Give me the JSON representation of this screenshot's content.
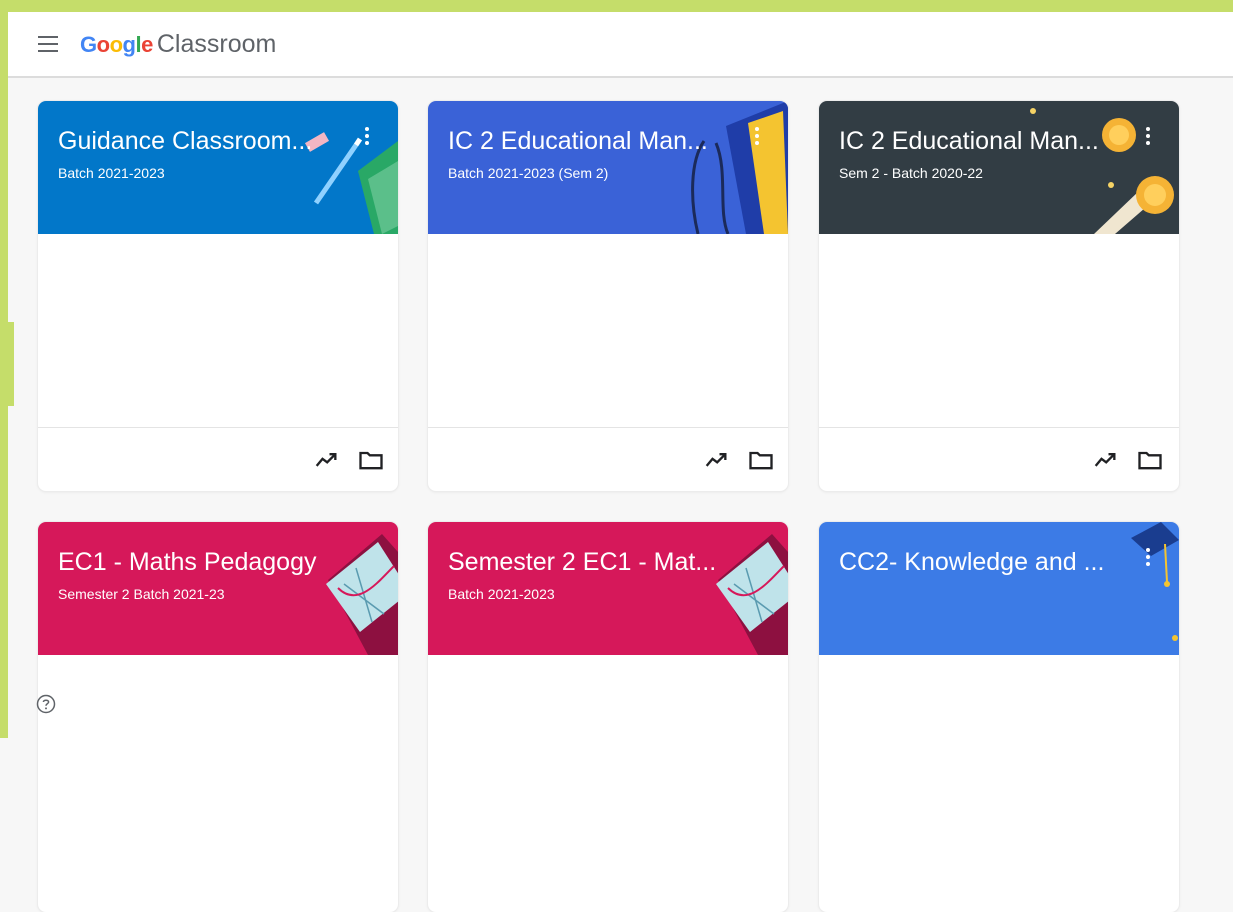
{
  "app": {
    "logo_google": [
      "G",
      "o",
      "o",
      "g",
      "l",
      "e"
    ],
    "logo_classroom": "Classroom",
    "icons": {
      "menu": "hamburger-menu-icon",
      "help": "help-circle-icon",
      "trend": "trending-up-icon",
      "folder": "folder-icon",
      "more": "more-vert-icon"
    }
  },
  "cards": [
    {
      "title": "Guidance Classroom...",
      "subtitle": "Batch 2021-2023",
      "color": "#0277c9"
    },
    {
      "title": "IC 2 Educational Man...",
      "subtitle": "Batch 2021-2023 (Sem 2)",
      "color": "#3a62d7"
    },
    {
      "title": "IC 2 Educational Man...",
      "subtitle": "Sem 2 - Batch 2020-22",
      "color": "#323d44"
    },
    {
      "title": "EC1 - Maths Pedagogy",
      "subtitle": "Semester 2 Batch 2021-23",
      "color": "#d6185a"
    },
    {
      "title": "Semester 2 EC1 - Mat...",
      "subtitle": "Batch 2021-2023",
      "color": "#d6185a"
    },
    {
      "title": "CC2- Knowledge and ...",
      "subtitle": "",
      "color": "#3c7be6"
    }
  ],
  "colors": {
    "frame": "#c5dd6a",
    "header_bg": "#ffffff",
    "page_bg": "#f7f7f7"
  }
}
